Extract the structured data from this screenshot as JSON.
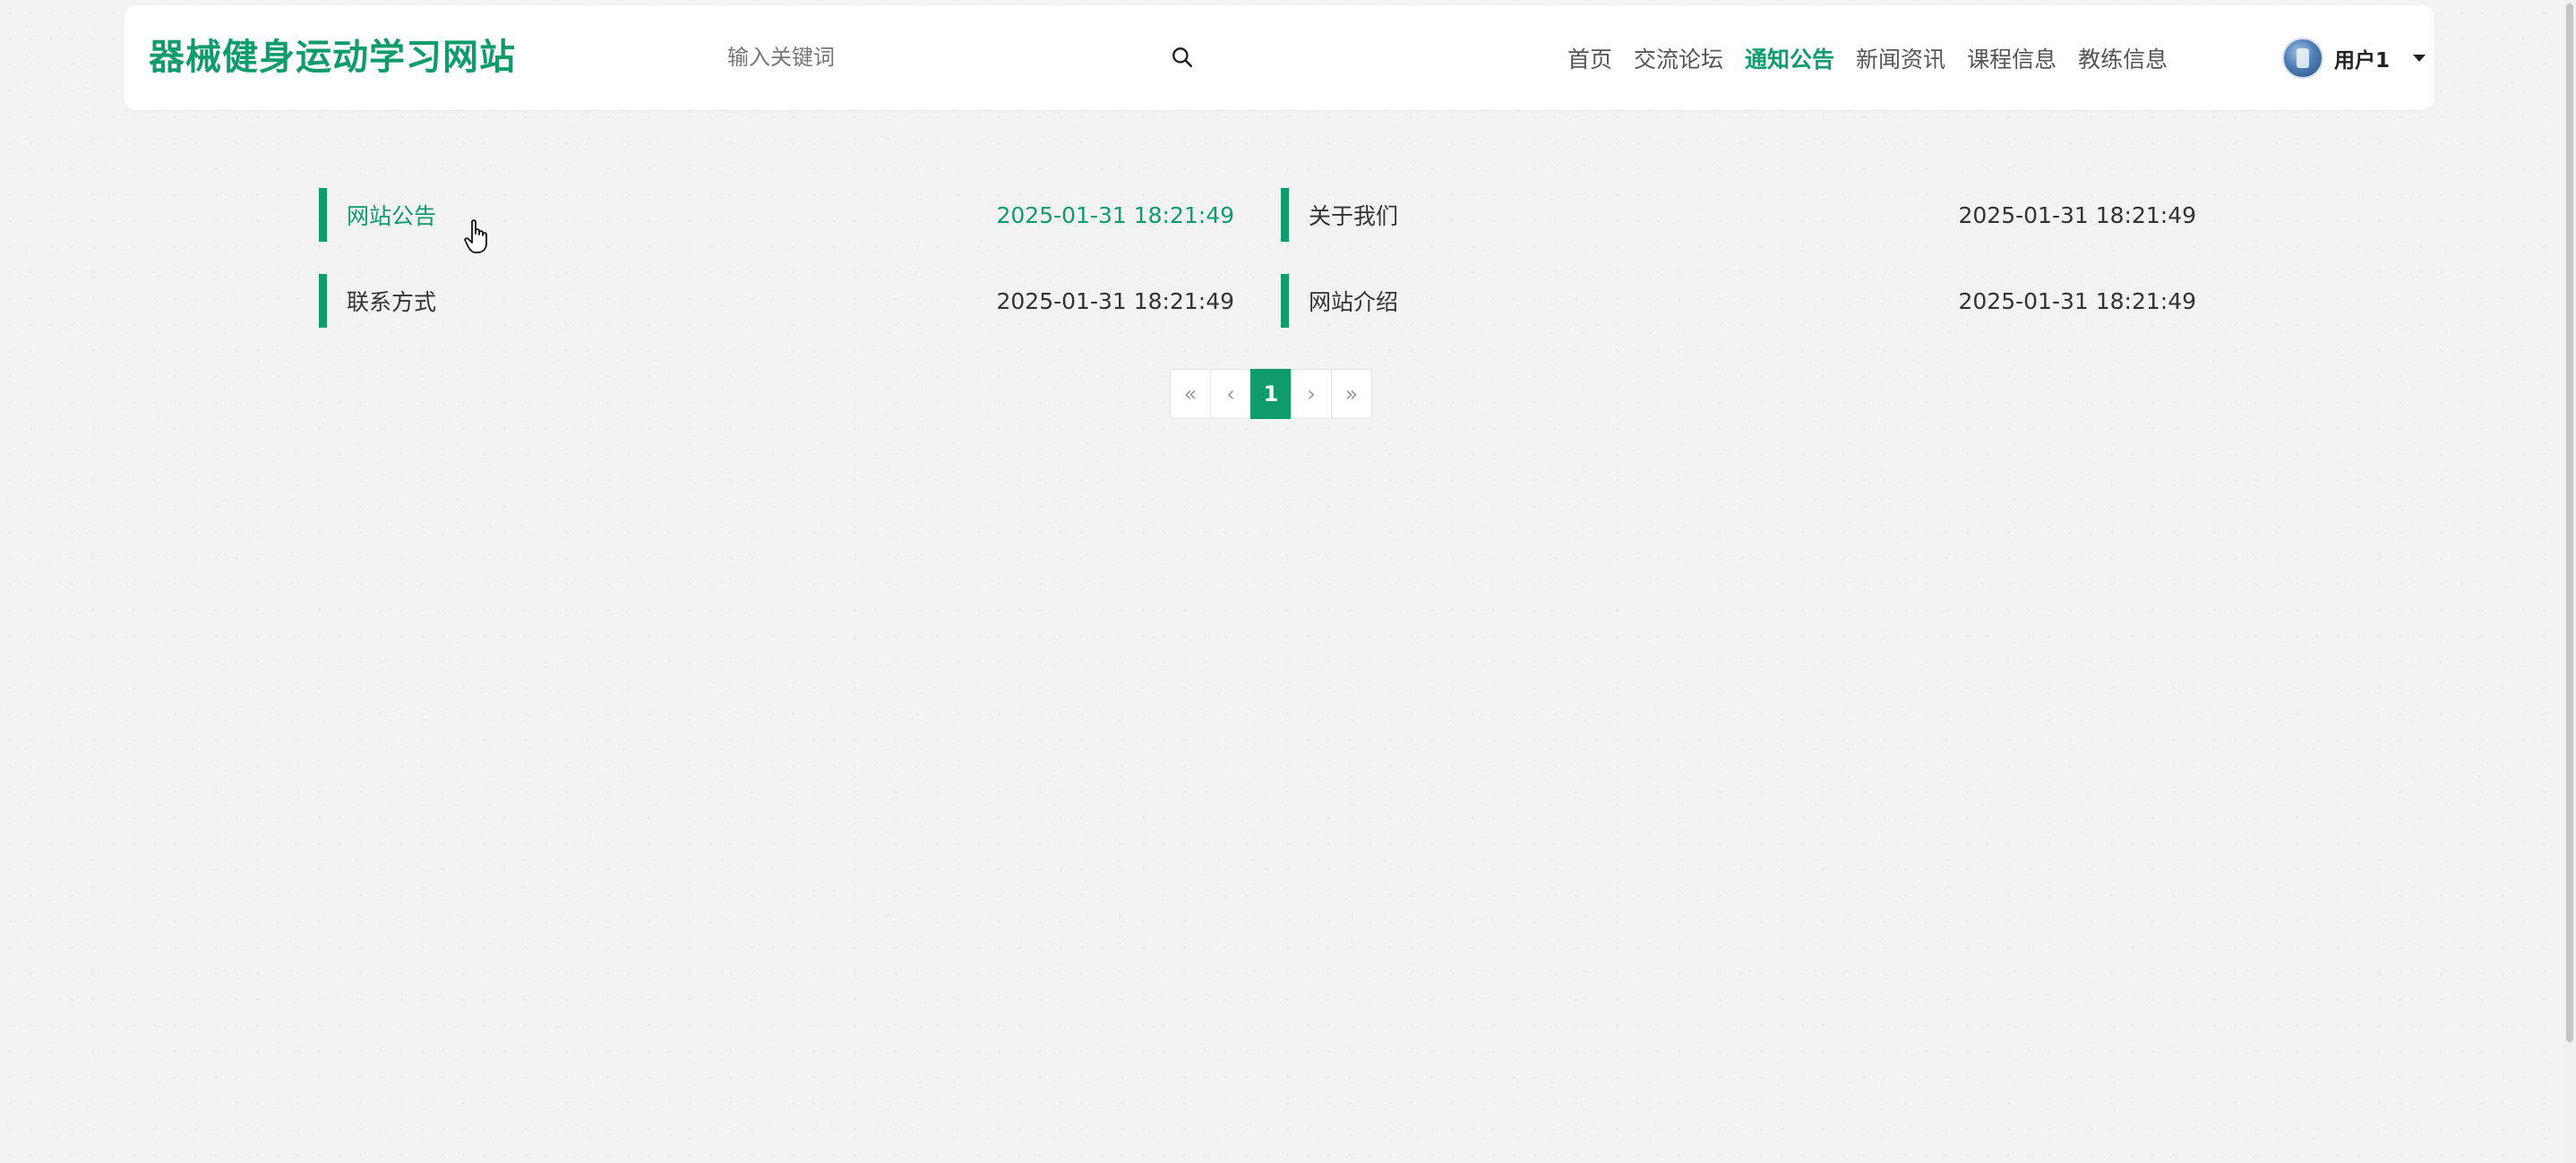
{
  "site": {
    "title": "器械健身运动学习网站"
  },
  "search": {
    "placeholder": "输入关键词",
    "icon": "search-icon"
  },
  "nav": {
    "items": [
      {
        "label": "首页",
        "active": false
      },
      {
        "label": "交流论坛",
        "active": false
      },
      {
        "label": "通知公告",
        "active": true
      },
      {
        "label": "新闻资讯",
        "active": false
      },
      {
        "label": "课程信息",
        "active": false
      },
      {
        "label": "教练信息",
        "active": false
      }
    ]
  },
  "user": {
    "name": "用户1"
  },
  "notices": [
    {
      "title": "网站公告",
      "date": "2025-01-31 18:21:49",
      "highlighted": true
    },
    {
      "title": "关于我们",
      "date": "2025-01-31 18:21:49",
      "highlighted": false
    },
    {
      "title": "联系方式",
      "date": "2025-01-31 18:21:49",
      "highlighted": false
    },
    {
      "title": "网站介绍",
      "date": "2025-01-31 18:21:49",
      "highlighted": false
    }
  ],
  "pagination": {
    "first": "«",
    "prev": "‹",
    "current": "1",
    "next": "›",
    "last": "»"
  },
  "colors": {
    "accent": "#0f9b6b",
    "text": "#333333",
    "muted": "#999999"
  }
}
